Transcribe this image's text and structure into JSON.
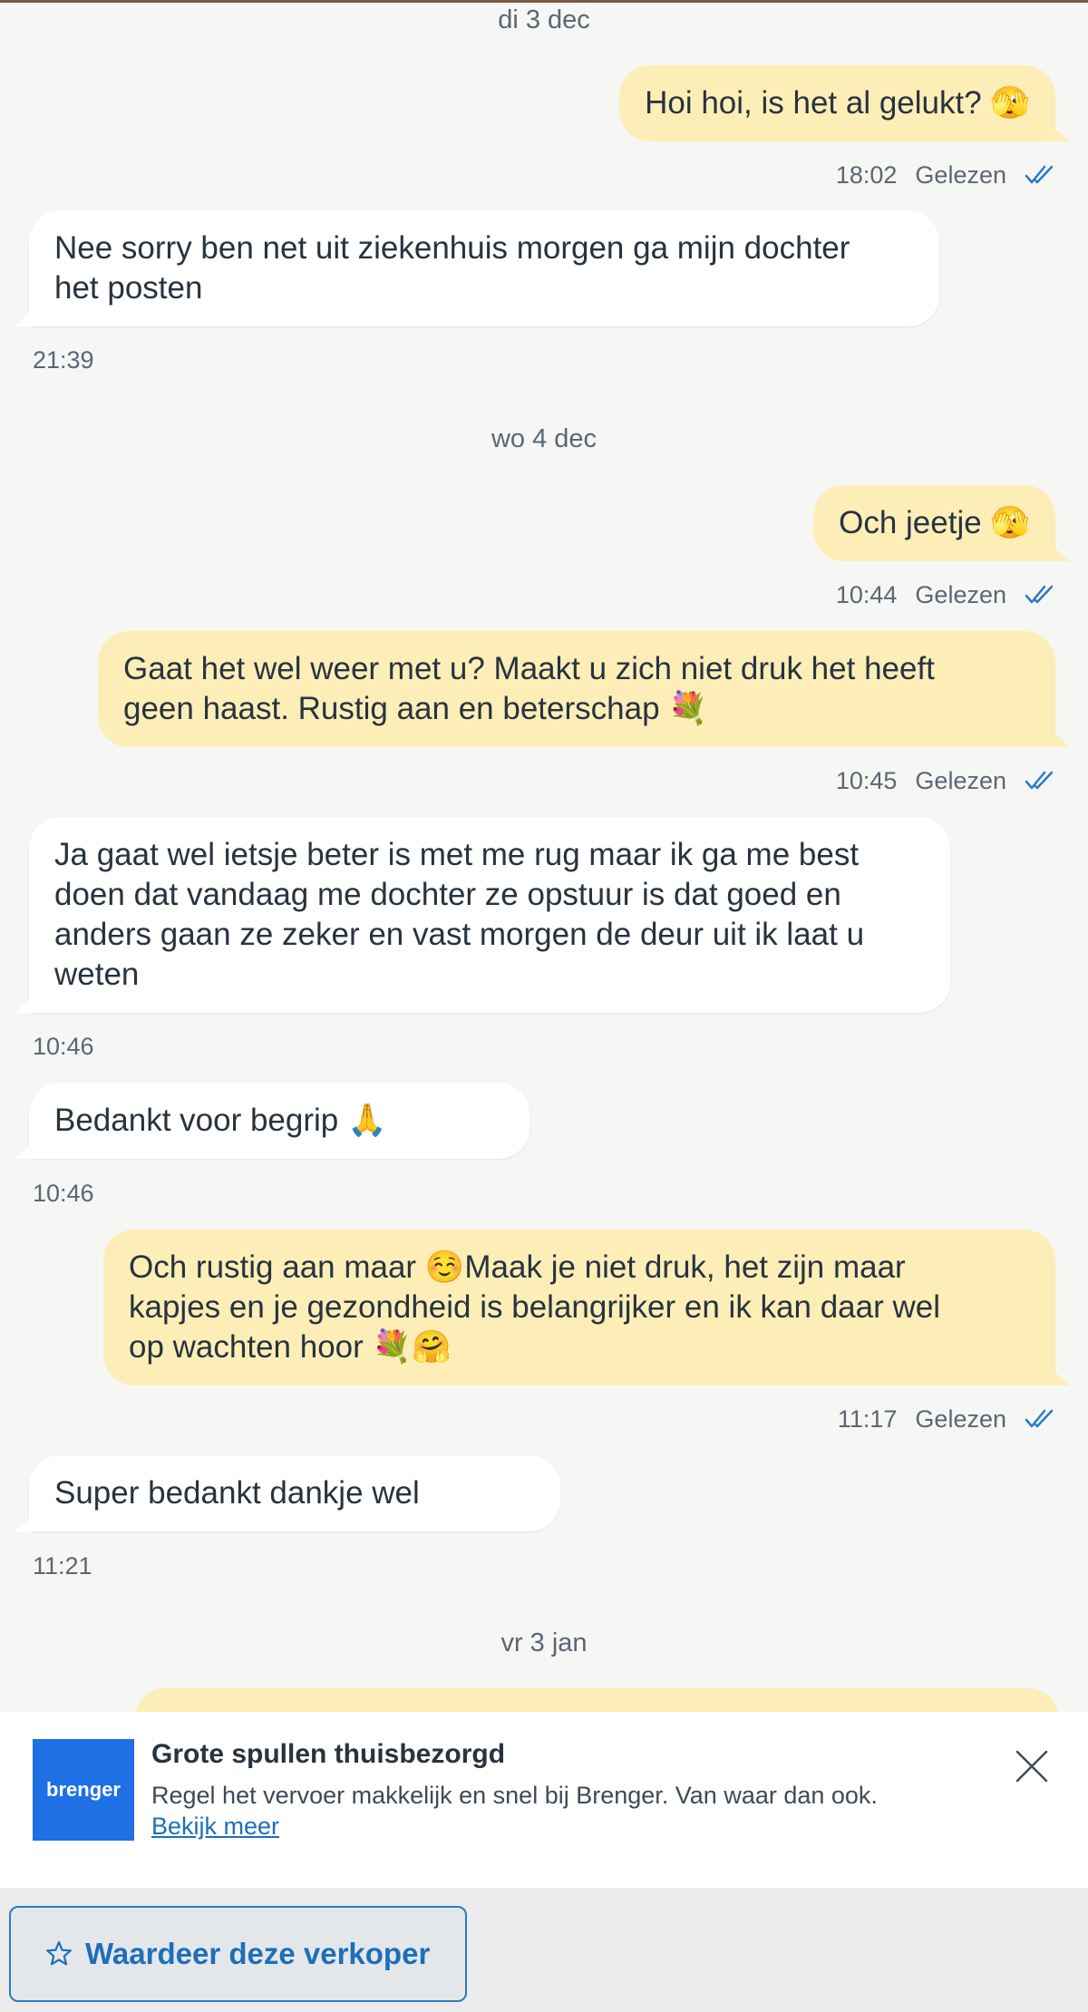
{
  "colors": {
    "outgoing_bubble": "#fdeeb8",
    "incoming_bubble": "#ffffff",
    "read_check": "#2c7bc6",
    "background": "#f6f6f4",
    "brand_blue": "#1f6fe5"
  },
  "dates": [
    "di 3 dec",
    "wo 4 dec",
    "vr 3 jan"
  ],
  "messages": [
    {
      "direction": "out",
      "text": "Hoi hoi, is het al gelukt? 🫣",
      "time": "18:02",
      "status": "Gelezen"
    },
    {
      "direction": "in",
      "text": "Nee sorry ben net uit ziekenhuis morgen ga mijn dochter\nhet posten",
      "time": "21:39"
    },
    {
      "direction": "out",
      "text": "Och jeetje 🫣",
      "time": "10:44",
      "status": "Gelezen"
    },
    {
      "direction": "out",
      "text": "Gaat het wel weer met u? Maakt u zich niet druk het heeft\ngeen haast. Rustig aan en beterschap 💐",
      "time": "10:45",
      "status": "Gelezen"
    },
    {
      "direction": "in",
      "text": "Ja gaat wel ietsje beter is met me rug maar ik ga me best\ndoen dat vandaag me dochter ze opstuur is dat goed en\nanders gaan ze zeker en vast morgen de deur uit ik laat u\nweten",
      "time": "10:46"
    },
    {
      "direction": "in",
      "text": "Bedankt voor begrip 🙏",
      "time": "10:46"
    },
    {
      "direction": "out",
      "text": "Och rustig aan maar ☺️Maak je niet druk, het zijn maar\nkapjes en je gezondheid is belangrijker en ik kan daar wel\nop wachten hoor 💐🤗",
      "time": "11:17",
      "status": "Gelezen"
    },
    {
      "direction": "in",
      "text": "Super bedankt dankje wel",
      "time": "11:21"
    }
  ],
  "ad": {
    "logo_text": "brenger",
    "title": "Grote spullen thuisbezorgd",
    "description": "Regel het vervoer makkelijk en snel bij Brenger. Van waar dan ook.",
    "link": "Bekijk meer",
    "close_icon": "close-icon"
  },
  "rate_button": {
    "label": "Waardeer deze verkoper",
    "icon": "star-outline-icon"
  }
}
